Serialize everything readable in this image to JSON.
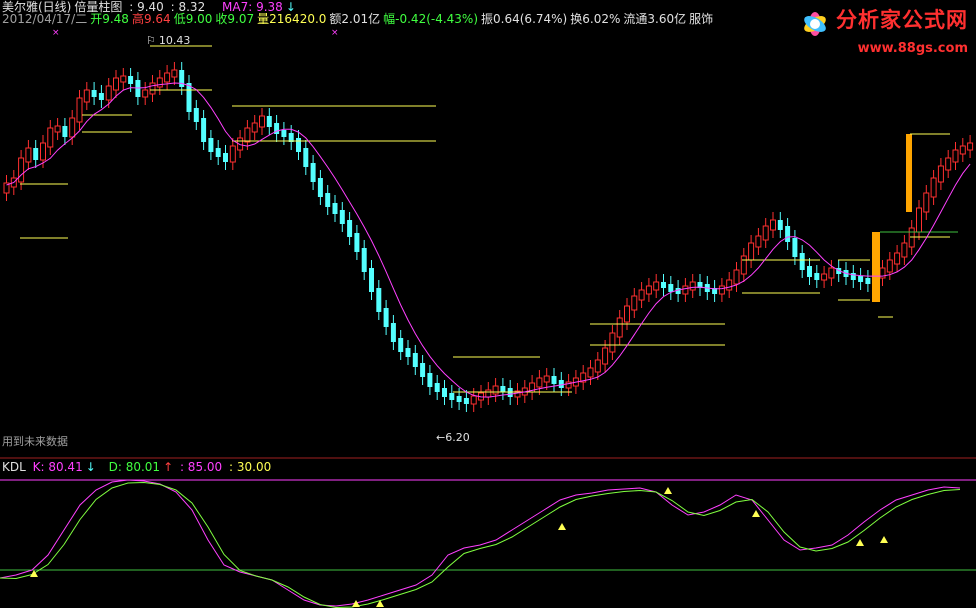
{
  "header": {
    "name": "美尔雅(日线)",
    "indicator": "倍量柱图",
    "ind_val1": ": 9.40",
    "ind_val2": ": 8.32",
    "ma_label": "MA7: 9.38",
    "ma_arrow": "↓"
  },
  "quote": {
    "date": "2012/04/17/二",
    "open": "开9.48",
    "high": "高9.64",
    "low": "低9.00",
    "close": "收9.07",
    "volume": "量216420.0",
    "amount": "额2.01亿",
    "change": "幅-0.42(-4.43%)",
    "amplitude": "振0.64(6.74%)",
    "turnover": "换6.02%",
    "float": "流通3.60亿",
    "sector": "服饰"
  },
  "annotations": {
    "high_label": "10.43",
    "low_label": "←6.20",
    "future_data_label": "用到未来数据"
  },
  "kdl": {
    "name": "KDL",
    "k": "K: 80.41",
    "k_arrow": "↓",
    "d": "D: 80.01",
    "d_arrow": "↑",
    "upper": ": 85.00",
    "lower": ": 30.00"
  },
  "logo": {
    "title": "分析家公式网",
    "url": "www.88gs.com"
  },
  "colors": {
    "up": "#ff3030",
    "down": "#54ffff",
    "ma": "#ff40ff",
    "k_line": "#ff40ff",
    "d_line": "#80ff40",
    "level_lines": "#ffff54",
    "double_volume": "#ffa500"
  },
  "chart_data": {
    "type": "candlestick",
    "price_range": [
      6.2,
      10.43
    ],
    "kdl_levels": [
      85,
      30
    ],
    "k_value": 80.41,
    "d_value": 80.01
  }
}
